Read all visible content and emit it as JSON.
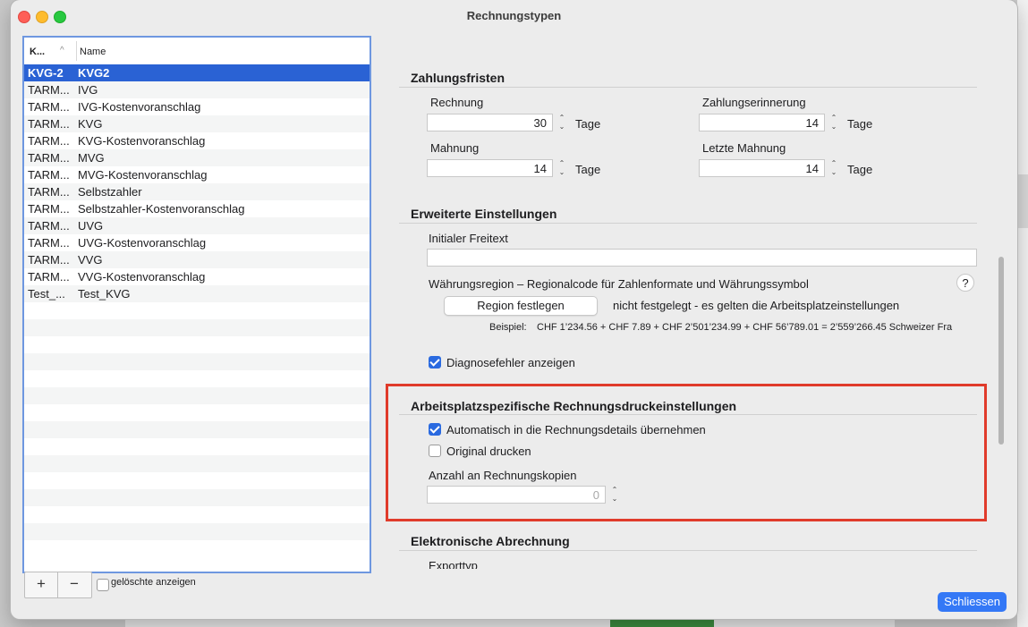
{
  "window": {
    "title": "Rechnungstypen"
  },
  "table": {
    "col1": "K...",
    "col2": "Name",
    "rows": [
      {
        "code": "KVG-2",
        "name": "KVG2",
        "selected": true
      },
      {
        "code": "TARM...",
        "name": "IVG"
      },
      {
        "code": "TARM...",
        "name": "IVG-Kostenvoranschlag"
      },
      {
        "code": "TARM...",
        "name": "KVG"
      },
      {
        "code": "TARM...",
        "name": "KVG-Kostenvoranschlag"
      },
      {
        "code": "TARM...",
        "name": "MVG"
      },
      {
        "code": "TARM...",
        "name": "MVG-Kostenvoranschlag"
      },
      {
        "code": "TARM...",
        "name": "Selbstzahler"
      },
      {
        "code": "TARM...",
        "name": "Selbstzahler-Kostenvoranschlag"
      },
      {
        "code": "TARM...",
        "name": "UVG"
      },
      {
        "code": "TARM...",
        "name": "UVG-Kostenvoranschlag"
      },
      {
        "code": "TARM...",
        "name": "VVG"
      },
      {
        "code": "TARM...",
        "name": "VVG-Kostenvoranschlag"
      },
      {
        "code": "Test_...",
        "name": "Test_KVG"
      }
    ],
    "add": "+",
    "remove": "−",
    "show_deleted": "gelöschte anzeigen"
  },
  "zahlungsfristen": {
    "title": "Zahlungsfristen",
    "rechnung_label": "Rechnung",
    "rechnung_value": "30",
    "erinnerung_label": "Zahlungserinnerung",
    "erinnerung_value": "14",
    "mahnung_label": "Mahnung",
    "mahnung_value": "14",
    "letzte_label": "Letzte Mahnung",
    "letzte_value": "14",
    "unit": "Tage"
  },
  "erweitert": {
    "title": "Erweiterte Einstellungen",
    "freitext_label": "Initialer Freitext",
    "freitext_value": "",
    "region_label": "Währungsregion – Regionalcode für Zahlenformate und Währungssymbol",
    "help": "?",
    "region_button": "Region festlegen",
    "region_status": "nicht festgelegt - es gelten die Arbeitsplatzeinstellungen",
    "beispiel_label": "Beispiel:",
    "beispiel_value": "CHF 1’234.56 + CHF 7.89 + CHF 2’501’234.99 + CHF 56’789.01 = 2’559’266.45 Schweizer Fra",
    "diagnose_label": "Diagnosefehler anzeigen",
    "diagnose_checked": true
  },
  "druck": {
    "title": "Arbeitsplatzspezifische Rechnungsdruckeinstellungen",
    "auto_label": "Automatisch in die Rechnungsdetails übernehmen",
    "auto_checked": true,
    "original_label": "Original drucken",
    "original_checked": false,
    "kopien_label": "Anzahl an Rechnungskopien",
    "kopien_value": "0"
  },
  "elektronisch": {
    "title": "Elektronische Abrechnung",
    "export_label": "Exporttyp"
  },
  "close_button": "Schliessen",
  "colors": {
    "accent": "#2a62d4",
    "highlight": "#e03b2b"
  }
}
